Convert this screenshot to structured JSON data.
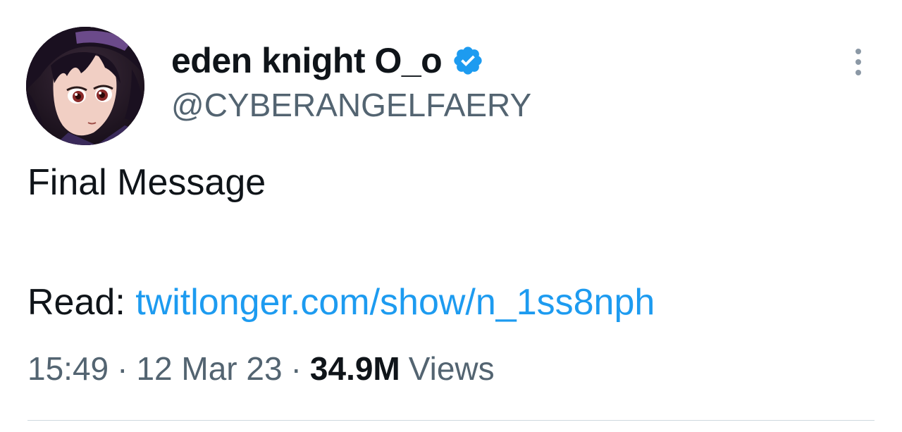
{
  "author": {
    "display_name": "eden knight O_o",
    "handle": "@CYBERANGELFAERY",
    "verified_icon": "verified-badge-icon",
    "avatar_icon": "anime-profile-avatar"
  },
  "menu": {
    "icon": "more-options-icon"
  },
  "tweet": {
    "line1": "Final Message",
    "read_label": "Read:",
    "link_text": "twitlonger.com/show/n_1ss8nph"
  },
  "meta": {
    "time": "15:49",
    "separator": "·",
    "date": "12 Mar 23",
    "views_count": "34.9M",
    "views_label": "Views"
  },
  "colors": {
    "text": "#0f1419",
    "secondary": "#536471",
    "link": "#1d9bf0",
    "verified": "#1d9bf0",
    "divider": "#cfd9de"
  }
}
